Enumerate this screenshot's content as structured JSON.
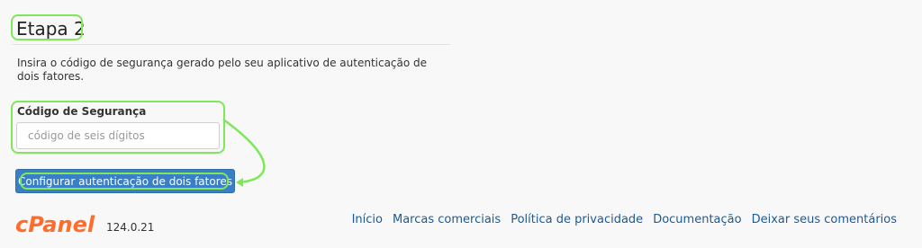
{
  "step": {
    "title": "Etapa 2",
    "instructions": "Insira o código de segurança gerado pelo seu aplicativo de autenticação de dois fatores."
  },
  "form": {
    "label": "Código de Segurança",
    "placeholder": "código de seis dígitos",
    "value": "",
    "submit_label": "Configurar autenticação de dois fatores"
  },
  "footer": {
    "logo_text": "cPanel",
    "version": "124.0.21",
    "links": [
      "Início",
      "Marcas comerciais",
      "Política de privacidade",
      "Documentação",
      "Deixar seus comentários"
    ]
  },
  "colors": {
    "highlight": "#7ee858",
    "button": "#3a7fc5",
    "logo": "#ff6c2c",
    "link": "#1b5a99"
  }
}
